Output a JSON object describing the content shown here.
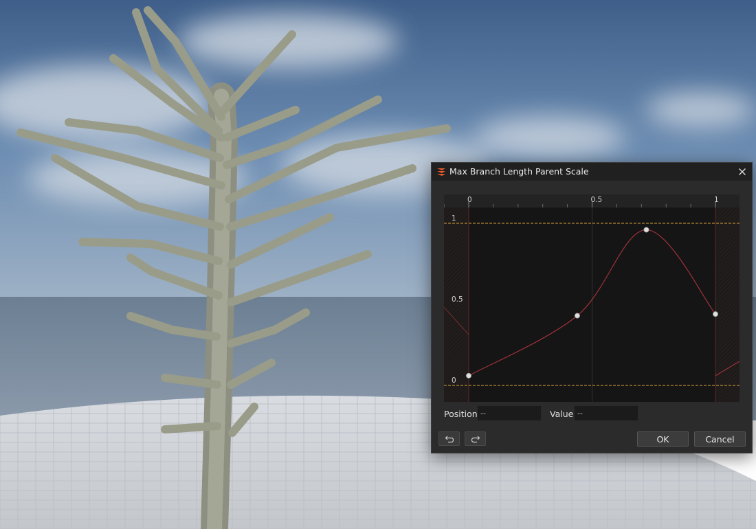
{
  "dialog": {
    "title": "Max Branch Length Parent Scale",
    "app_icon": "layers-logo-icon",
    "close_icon": "close-icon"
  },
  "curve": {
    "x_ticks": [
      {
        "value": 0,
        "label": "0"
      },
      {
        "value": 0.5,
        "label": "0.5"
      },
      {
        "value": 1,
        "label": "1"
      }
    ],
    "y_labels": [
      {
        "value": 1,
        "label": "1"
      },
      {
        "value": 0.5,
        "label": "0.5"
      },
      {
        "value": 0,
        "label": "0"
      }
    ],
    "points": [
      {
        "x": 0.0,
        "y": 0.06
      },
      {
        "x": 0.44,
        "y": 0.43
      },
      {
        "x": 0.72,
        "y": 0.96
      },
      {
        "x": 1.0,
        "y": 0.44
      }
    ],
    "curve_color": "#a0323a",
    "limit_line_color": "#d9a43a"
  },
  "fields": {
    "position_label": "Position",
    "position_value": "--",
    "value_label": "Value",
    "value_value": "--"
  },
  "buttons": {
    "undo_icon": "undo-icon",
    "redo_icon": "redo-icon",
    "ok_label": "OK",
    "cancel_label": "Cancel"
  }
}
